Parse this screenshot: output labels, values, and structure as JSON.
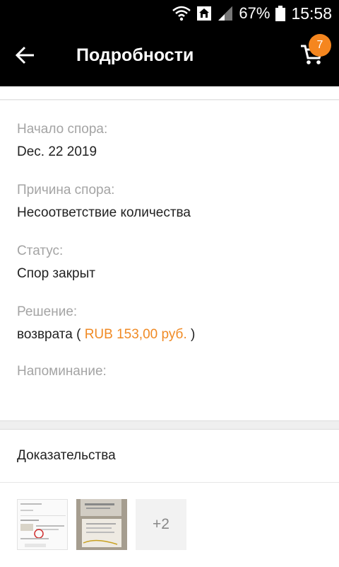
{
  "status_bar": {
    "battery_percent": "67%",
    "time": "15:58",
    "icons": [
      "wifi-icon",
      "home-icon",
      "signal-icon",
      "battery-icon"
    ]
  },
  "toolbar": {
    "title": "Подробности",
    "cart_count": "7",
    "icons": [
      "back-arrow-icon",
      "cart-icon"
    ]
  },
  "dispute": {
    "start_label": "Начало спора:",
    "start_value": "Dec. 22 2019",
    "reason_label": "Причина спора:",
    "reason_value": "Несоответствие количества",
    "status_label": "Статус:",
    "status_value": "Спор закрыт",
    "decision_label": "Решение:",
    "decision_prefix": "возврата (",
    "decision_amount": "RUB 153,00 руб.",
    "decision_suffix": ")",
    "reminder_label": "Напоминание:"
  },
  "evidence": {
    "title": "Доказательства",
    "more_count": "+2"
  },
  "colors": {
    "accent": "#f08a24",
    "badge": "#f5861f",
    "toolbar_bg": "#000000"
  }
}
